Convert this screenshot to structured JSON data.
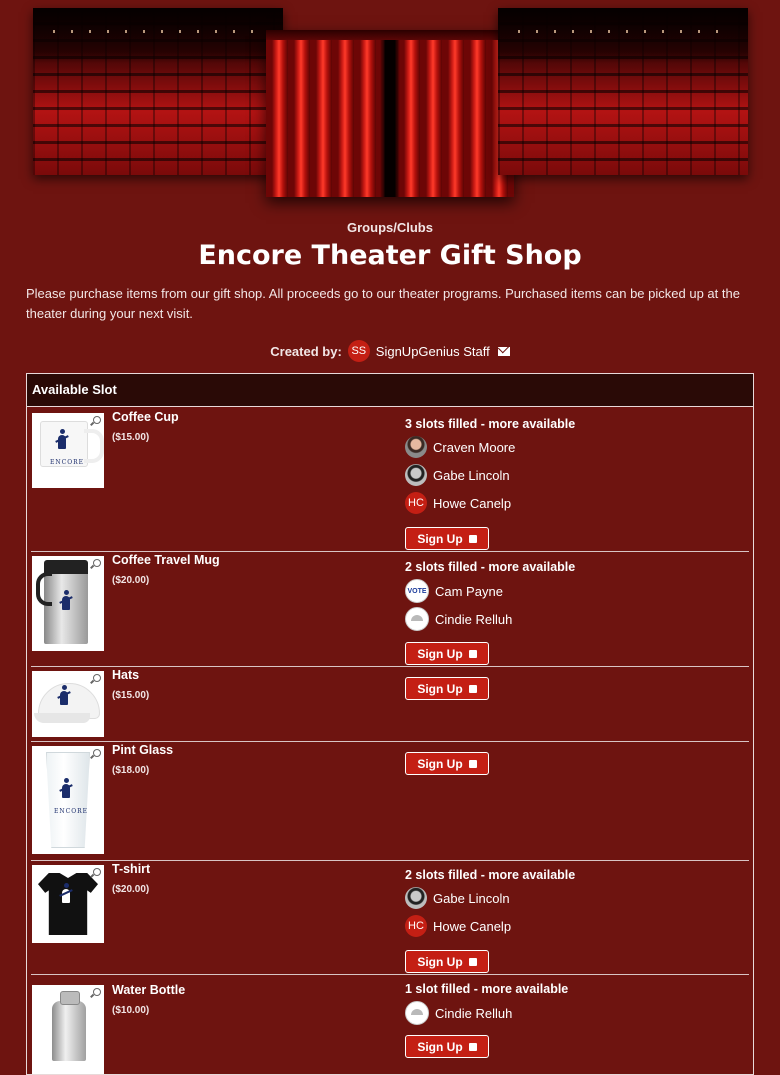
{
  "header": {
    "category": "Groups/Clubs",
    "title": "Encore Theater Gift Shop",
    "description": "Please purchase items from our gift shop. All proceeds go to our theater programs. Purchased items can be picked up at the theater during your next visit.",
    "created_by_label": "Created by:",
    "creator_initials": "SS",
    "creator_name": "SignUpGenius Staff"
  },
  "table": {
    "column_header": "Available Slot",
    "signup_label": "Sign Up",
    "items": [
      {
        "name": "Coffee Cup",
        "price": "($15.00)",
        "status": "3 slots filled - more available",
        "people": [
          {
            "name": "Craven Moore",
            "avatar": "photo"
          },
          {
            "name": "Gabe Lincoln",
            "avatar": "lincoln"
          },
          {
            "name": "Howe Canelp",
            "avatar": "initials",
            "initials": "HC"
          }
        ]
      },
      {
        "name": "Coffee Travel Mug",
        "price": "($20.00)",
        "status": "2 slots filled - more available",
        "people": [
          {
            "name": "Cam Payne",
            "avatar": "vote-badge",
            "badge_text": "VOTE"
          },
          {
            "name": "Cindie Relluh",
            "avatar": "ring"
          }
        ]
      },
      {
        "name": "Hats",
        "price": "($15.00)",
        "status": "",
        "people": []
      },
      {
        "name": "Pint Glass",
        "price": "($18.00)",
        "status": "",
        "people": []
      },
      {
        "name": "T-shirt",
        "price": "($20.00)",
        "status": "2 slots filled - more available",
        "people": [
          {
            "name": "Gabe Lincoln",
            "avatar": "lincoln"
          },
          {
            "name": "Howe Canelp",
            "avatar": "initials",
            "initials": "HC"
          }
        ]
      },
      {
        "name": "Water Bottle",
        "price": "($10.00)",
        "status": "1 slot filled - more available",
        "people": [
          {
            "name": "Cindie Relluh",
            "avatar": "ring"
          }
        ]
      }
    ]
  },
  "product_brand_text": "ENCORE",
  "colors": {
    "page_background": "#6e1410",
    "header_row": "#2a0a06",
    "accent_button": "#c41f14",
    "text": "#ffffff"
  },
  "icons": {
    "email": "envelope-icon",
    "zoom": "magnifier-icon",
    "checkbox": "checkbox-icon"
  }
}
